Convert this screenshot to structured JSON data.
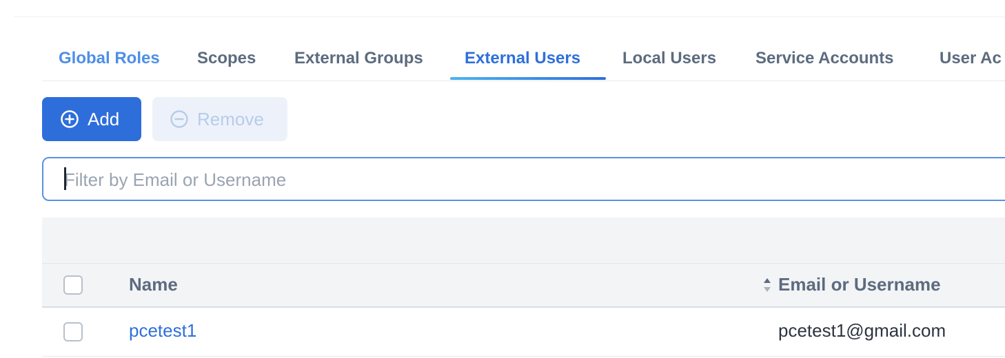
{
  "tabs": [
    {
      "label": "Global Roles"
    },
    {
      "label": "Scopes"
    },
    {
      "label": "External Groups"
    },
    {
      "label": "External Users",
      "active": true
    },
    {
      "label": "Local Users"
    },
    {
      "label": "Service Accounts"
    },
    {
      "label": "User Ac"
    }
  ],
  "toolbar": {
    "add_label": "Add",
    "add_icon": "plus-circle-icon",
    "remove_label": "Remove",
    "remove_icon": "minus-circle-icon",
    "remove_disabled": true
  },
  "filter": {
    "placeholder": "Filter by Email or Username",
    "value": ""
  },
  "table": {
    "columns": [
      {
        "label": "Name"
      },
      {
        "label": "Email or Username",
        "sortable": true
      }
    ],
    "rows": [
      {
        "name": "pcetest1",
        "email": "pcetest1@gmail.com",
        "selected": false
      }
    ]
  },
  "colors": {
    "accent": "#2e6edb",
    "tab_text": "#5c6b7f",
    "disabled_button_bg": "#edf2fa"
  }
}
